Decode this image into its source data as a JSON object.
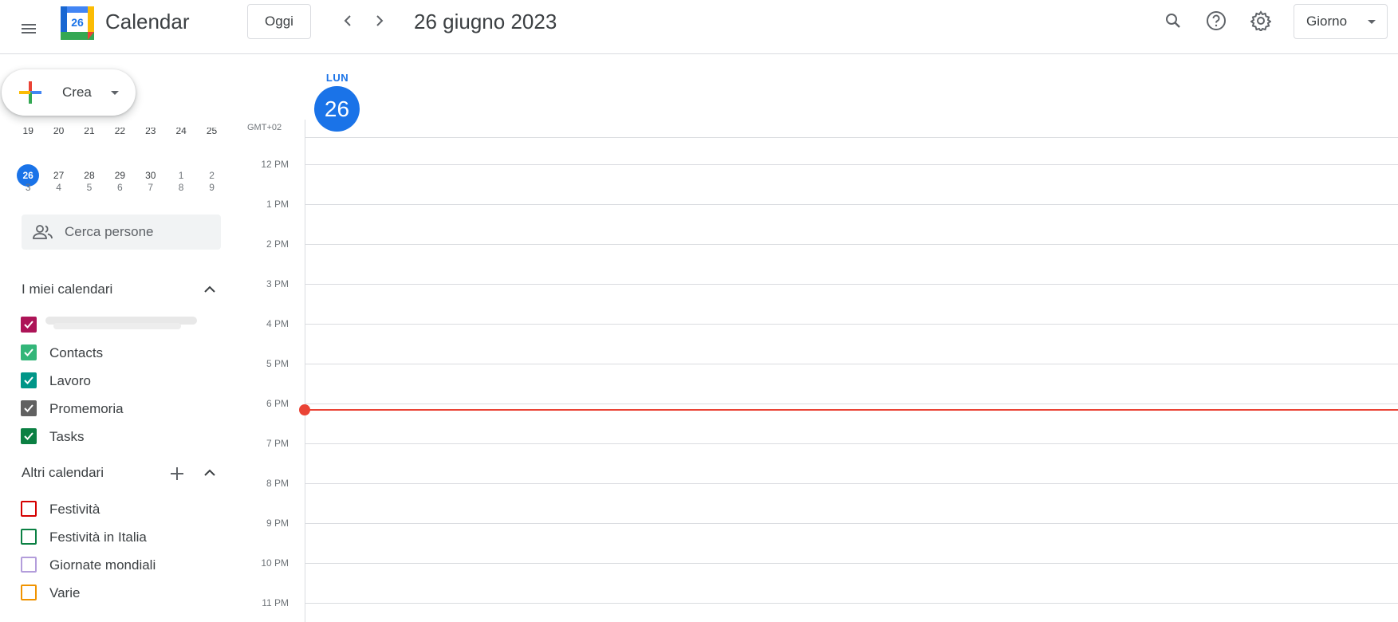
{
  "header": {
    "app_title": "Calendar",
    "logo_day": "26",
    "today_label": "Oggi",
    "date_title": "26 giugno 2023",
    "view_selected": "Giorno"
  },
  "sidebar": {
    "create_label": "Crea",
    "mini_calendar": {
      "rows": [
        [
          "19",
          "20",
          "21",
          "22",
          "23",
          "24",
          "25"
        ],
        [
          "26",
          "27",
          "28",
          "29",
          "30",
          "1",
          "2"
        ],
        [
          "3",
          "4",
          "5",
          "6",
          "7",
          "8",
          "9"
        ]
      ],
      "selected_day": "26"
    },
    "people_search_placeholder": "Cerca persone",
    "my_calendars": {
      "heading": "I miei calendari",
      "items": [
        {
          "label": "",
          "color": "#ad1457",
          "checked": true
        },
        {
          "label": "Contacts",
          "color": "#33b679",
          "checked": true
        },
        {
          "label": "Lavoro",
          "color": "#009688",
          "checked": true
        },
        {
          "label": "Promemoria",
          "color": "#616161",
          "checked": true
        },
        {
          "label": "Tasks",
          "color": "#0b8043",
          "checked": true
        }
      ]
    },
    "other_calendars": {
      "heading": "Altri calendari",
      "items": [
        {
          "label": "Festività",
          "color": "#d50000",
          "checked": false
        },
        {
          "label": "Festività in Italia",
          "color": "#0b8043",
          "checked": false
        },
        {
          "label": "Giornate mondiali",
          "color": "#b39ddb",
          "checked": false
        },
        {
          "label": "Varie",
          "color": "#f09300",
          "checked": false
        }
      ]
    }
  },
  "main": {
    "day_of_week": "LUN",
    "day_number": "26",
    "timezone": "GMT+02",
    "hours": [
      "12 PM",
      "1 PM",
      "2 PM",
      "3 PM",
      "4 PM",
      "5 PM",
      "6 PM",
      "7 PM",
      "8 PM",
      "9 PM",
      "10 PM",
      "11 PM"
    ],
    "now_indicator_color": "#ea4335"
  },
  "colors": {
    "accent": "#1a73e8",
    "border": "#dadce0"
  }
}
